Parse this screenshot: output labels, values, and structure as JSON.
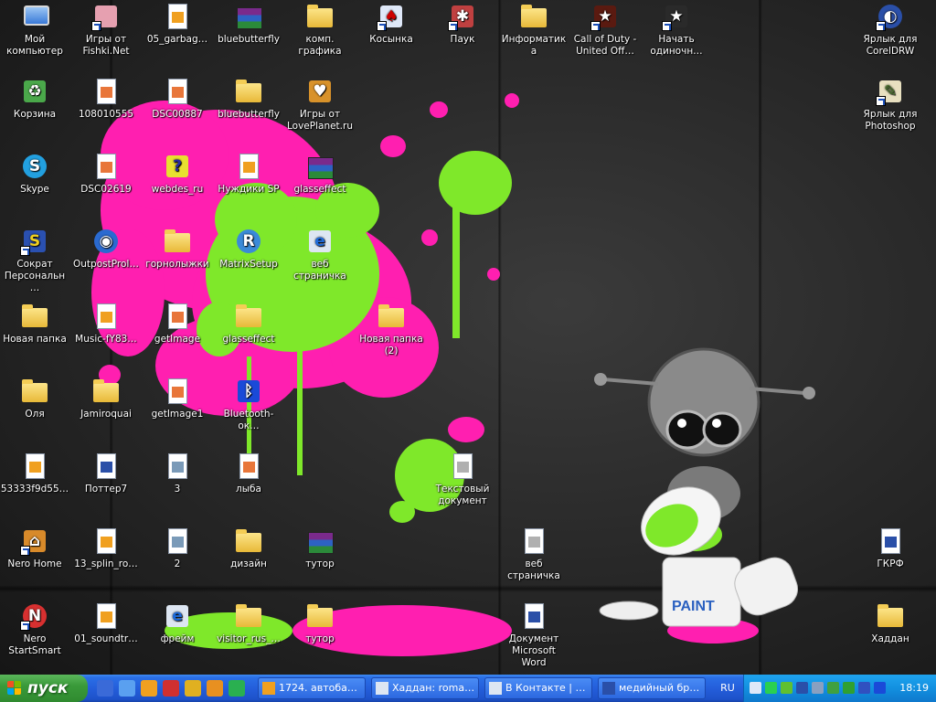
{
  "desktop": {
    "icons": [
      {
        "label": "Мой компьютер",
        "icon": "my-computer-icon",
        "type": "computer",
        "col": 0,
        "row": 0
      },
      {
        "label": "Игры от Fishki.Net",
        "icon": "pig-game-icon",
        "type": "box",
        "color": "#e6a0b0",
        "char": "",
        "shortcut": true,
        "col": 1,
        "row": 0
      },
      {
        "label": "05_garbag…",
        "icon": "winamp-file-icon",
        "type": "doc",
        "color": "#f0a020",
        "col": 2,
        "row": 0
      },
      {
        "label": "bluebutterfly",
        "icon": "winrar-archive-icon",
        "type": "rar",
        "col": 3,
        "row": 0
      },
      {
        "label": "комп. графика",
        "icon": "folder-icon",
        "type": "folder",
        "col": 4,
        "row": 0
      },
      {
        "label": "Косынка",
        "icon": "solitaire-icon",
        "type": "box",
        "color": "#dfe8f8",
        "char": "♠",
        "charcolor": "#c00",
        "shortcut": true,
        "col": 5,
        "row": 0
      },
      {
        "label": "Паук",
        "icon": "spider-solitaire-icon",
        "type": "box",
        "color": "#c04040",
        "char": "✱",
        "shortcut": true,
        "col": 6,
        "row": 0
      },
      {
        "label": "Информатика",
        "icon": "folder-icon",
        "type": "folder",
        "col": 7,
        "row": 0
      },
      {
        "label": "Call of Duty - United Off…",
        "icon": "call-of-duty-icon",
        "type": "box",
        "color": "#5a1a10",
        "char": "★",
        "shortcut": true,
        "col": 8,
        "row": 0
      },
      {
        "label": "Начать одиночн…",
        "icon": "call-of-duty-star-icon",
        "type": "box",
        "color": "#2a2a2a",
        "char": "★",
        "shortcut": true,
        "col": 9,
        "row": 0
      },
      {
        "label": "Ярлык для CorelDRW",
        "icon": "coreldraw-icon",
        "type": "circle",
        "color": "#2a4fa8",
        "char": "◐",
        "shortcut": true,
        "col": 12,
        "row": 0
      },
      {
        "label": "Корзина",
        "icon": "recycle-bin-icon",
        "type": "box",
        "color": "#4aa84a",
        "char": "♻",
        "col": 0,
        "row": 1
      },
      {
        "label": "108010555",
        "icon": "image-file-icon",
        "type": "doc",
        "color": "#e8763a",
        "col": 1,
        "row": 1
      },
      {
        "label": "DSC00887",
        "icon": "image-file-icon",
        "type": "doc",
        "color": "#e8763a",
        "col": 2,
        "row": 1
      },
      {
        "label": "bluebutterfly",
        "icon": "folder-icon",
        "type": "folder",
        "col": 3,
        "row": 1
      },
      {
        "label": "Игры от LovePlanet.ru",
        "icon": "loveplanet-games-icon",
        "type": "box",
        "color": "#d8922a",
        "char": "♥",
        "col": 4,
        "row": 1
      },
      {
        "label": "Ярлык для Photoshop",
        "icon": "photoshop-icon",
        "type": "box",
        "color": "#e8e0c0",
        "char": "✎",
        "charcolor": "#4a7a2a",
        "shortcut": true,
        "col": 12,
        "row": 1
      },
      {
        "label": "Skype",
        "icon": "skype-icon",
        "type": "circle",
        "color": "#22a0e0",
        "char": "S",
        "col": 0,
        "row": 2
      },
      {
        "label": "DSC02619",
        "icon": "image-file-icon",
        "type": "doc",
        "color": "#e8763a",
        "col": 1,
        "row": 2
      },
      {
        "label": "webdes_ru",
        "icon": "help-file-icon",
        "type": "box",
        "color": "#e8e030",
        "char": "?",
        "charcolor": "#2a2aa0",
        "col": 2,
        "row": 2
      },
      {
        "label": "Нуждики SP",
        "icon": "winamp-file-icon",
        "type": "doc",
        "color": "#f0a020",
        "col": 3,
        "row": 2
      },
      {
        "label": "glasseffect",
        "icon": "winrar-archive-icon",
        "type": "rar",
        "col": 4,
        "row": 2
      },
      {
        "label": "Сократ Персональн…",
        "icon": "socrat-icon",
        "type": "box",
        "color": "#2a50b0",
        "char": "S",
        "charcolor": "#f0d020",
        "shortcut": true,
        "col": 0,
        "row": 3
      },
      {
        "label": "OutpostProI…",
        "icon": "outpost-firewall-icon",
        "type": "circle",
        "color": "#2a6ad0",
        "char": "◉",
        "col": 1,
        "row": 3
      },
      {
        "label": "горнолыжки",
        "icon": "folder-icon",
        "type": "folder",
        "col": 2,
        "row": 3
      },
      {
        "label": "MatrixSetup",
        "icon": "matrix-setup-icon",
        "type": "circle",
        "color": "#3a8ad8",
        "char": "R",
        "col": 3,
        "row": 3
      },
      {
        "label": "веб страничка",
        "icon": "internet-explorer-icon",
        "type": "box",
        "color": "#dde6f2",
        "char": "e",
        "charcolor": "#1e6ad8",
        "col": 4,
        "row": 3
      },
      {
        "label": "Новая папка",
        "icon": "folder-icon",
        "type": "folder",
        "col": 0,
        "row": 4
      },
      {
        "label": "Music-fY83…",
        "icon": "winamp-file-icon",
        "type": "doc",
        "color": "#f0a020",
        "col": 1,
        "row": 4
      },
      {
        "label": "getImage",
        "icon": "image-file-icon",
        "type": "doc",
        "color": "#e8763a",
        "col": 2,
        "row": 4
      },
      {
        "label": "glasseffect",
        "icon": "folder-icon",
        "type": "folder",
        "col": 3,
        "row": 4
      },
      {
        "label": "Новая папка (2)",
        "icon": "folder-icon",
        "type": "folder",
        "col": 5,
        "row": 4
      },
      {
        "label": "Оля",
        "icon": "folder-icon",
        "type": "folder",
        "col": 0,
        "row": 5
      },
      {
        "label": "Jamiroquai",
        "icon": "folder-icon",
        "type": "folder",
        "col": 1,
        "row": 5
      },
      {
        "label": "getImage1",
        "icon": "image-file-icon",
        "type": "doc",
        "color": "#e8763a",
        "col": 2,
        "row": 5
      },
      {
        "label": "Bluetooth-ок…",
        "icon": "bluetooth-icon",
        "type": "box",
        "color": "#1a4ad8",
        "char": "ᛒ",
        "col": 3,
        "row": 5
      },
      {
        "label": "53333f9d55…",
        "icon": "winamp-file-icon",
        "type": "doc",
        "color": "#f0a020",
        "col": 0,
        "row": 6
      },
      {
        "label": "Поттер7",
        "icon": "word-document-icon",
        "type": "doc",
        "color": "#2a4fa8",
        "col": 1,
        "row": 6
      },
      {
        "label": "3",
        "icon": "picture-file-icon",
        "type": "doc",
        "color": "#7a9ab8",
        "col": 2,
        "row": 6
      },
      {
        "label": "лыба",
        "icon": "image-file-icon",
        "type": "doc",
        "color": "#e8763a",
        "col": 3,
        "row": 6
      },
      {
        "label": "Текстовый документ",
        "icon": "text-document-icon",
        "type": "doc",
        "color": "#b0b0b0",
        "col": 6,
        "row": 6
      },
      {
        "label": "Nero Home",
        "icon": "nero-home-icon",
        "type": "box",
        "color": "#d88a2a",
        "char": "⌂",
        "shortcut": true,
        "col": 0,
        "row": 7
      },
      {
        "label": "13_splin_ro…",
        "icon": "winamp-file-icon",
        "type": "doc",
        "color": "#f0a020",
        "col": 1,
        "row": 7
      },
      {
        "label": "2",
        "icon": "picture-file-icon",
        "type": "doc",
        "color": "#7a9ab8",
        "col": 2,
        "row": 7
      },
      {
        "label": "дизайн",
        "icon": "folder-icon",
        "type": "folder",
        "col": 3,
        "row": 7
      },
      {
        "label": "тутор",
        "icon": "winrar-archive-icon",
        "type": "rar",
        "col": 4,
        "row": 7
      },
      {
        "label": "веб страничка",
        "icon": "text-document-icon",
        "type": "doc",
        "color": "#b0b0b0",
        "col": 7,
        "row": 7
      },
      {
        "label": "ГКРФ",
        "icon": "word-document-icon",
        "type": "doc",
        "color": "#2a4fa8",
        "col": 12,
        "row": 7
      },
      {
        "label": "Nero StartSmart",
        "icon": "nero-startsmart-icon",
        "type": "circle",
        "color": "#d83030",
        "char": "N",
        "shortcut": true,
        "col": 0,
        "row": 8
      },
      {
        "label": "01_soundtr…",
        "icon": "winamp-file-icon",
        "type": "doc",
        "color": "#f0a020",
        "col": 1,
        "row": 8
      },
      {
        "label": "фрейм",
        "icon": "internet-explorer-icon",
        "type": "box",
        "color": "#dde6f2",
        "char": "e",
        "charcolor": "#1e6ad8",
        "col": 2,
        "row": 8
      },
      {
        "label": "visitor_rus_…",
        "icon": "folder-icon",
        "type": "folder",
        "col": 3,
        "row": 8
      },
      {
        "label": "тутор",
        "icon": "folder-icon",
        "type": "folder",
        "col": 4,
        "row": 8
      },
      {
        "label": "Документ Microsoft Word",
        "icon": "word-document-icon",
        "type": "doc",
        "color": "#2a4fa8",
        "col": 7,
        "row": 8
      },
      {
        "label": "Хаддан",
        "icon": "folder-icon",
        "type": "folder",
        "col": 12,
        "row": 8
      }
    ]
  },
  "taskbar": {
    "start_label": "пуск",
    "quick_launch": [
      {
        "icon": "show-desktop-icon",
        "color": "#3a6ad8"
      },
      {
        "icon": "internet-explorer-icon",
        "color": "#5aa0f0"
      },
      {
        "icon": "media-player-icon",
        "color": "#f0a020"
      },
      {
        "icon": "opera-icon",
        "color": "#d03030"
      },
      {
        "icon": "messenger-icon",
        "color": "#e0b020"
      },
      {
        "icon": "winamp-icon",
        "color": "#e89020"
      },
      {
        "icon": "globe-icon",
        "color": "#2ab050"
      }
    ],
    "tasks": [
      {
        "label": "1724. автоба…",
        "icon": "winamp-task-icon",
        "color": "#f0a020"
      },
      {
        "label": "Хаддан: roma…",
        "icon": "ie-task-icon",
        "color": "#dde6f2"
      },
      {
        "label": "В Контакте | …",
        "icon": "ie-task-icon",
        "color": "#dde6f2"
      },
      {
        "label": "медийный бр…",
        "icon": "word-task-icon",
        "color": "#2a4fa8"
      }
    ],
    "language": "RU",
    "tray_icons": [
      {
        "icon": "tray-arrow-icon",
        "color": "#dfe8f8"
      },
      {
        "icon": "tray-network-icon",
        "color": "#2ad050"
      },
      {
        "icon": "tray-checkmark-icon",
        "color": "#60c030"
      },
      {
        "icon": "tray-antivirus-icon",
        "color": "#2a4fa8"
      },
      {
        "icon": "tray-monitor-icon",
        "color": "#8aa0c0"
      },
      {
        "icon": "tray-connection-icon",
        "color": "#40a040"
      },
      {
        "icon": "tray-eye-icon",
        "color": "#30a030"
      },
      {
        "icon": "tray-security-icon",
        "color": "#3050c0"
      },
      {
        "icon": "tray-bluetooth-icon",
        "color": "#1a4ad8"
      }
    ],
    "clock": "18:19"
  }
}
